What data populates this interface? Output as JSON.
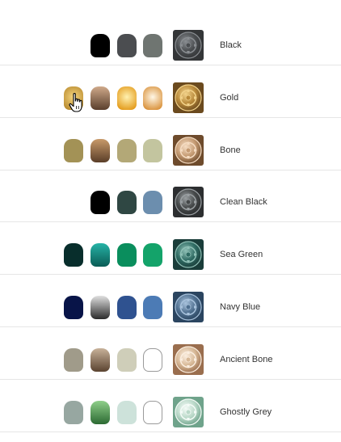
{
  "colours": [
    {
      "name": "Black",
      "thumb": {
        "bg": "#343638",
        "mid": "#4a4d50",
        "hi": "#8a8e92"
      },
      "pots": [
        {
          "type": "solid",
          "c": "#000000"
        },
        {
          "type": "solid",
          "c": "#4b4d50"
        },
        {
          "type": "solid",
          "c": "#6f7571"
        }
      ]
    },
    {
      "name": "Gold",
      "thumb": {
        "bg": "#6b4a1e",
        "mid": "#b8893a",
        "hi": "#f2d28a"
      },
      "pots": [
        {
          "type": "metal",
          "c1": "#f6d680",
          "c2": "#b88a2e"
        },
        {
          "type": "grad",
          "c1": "#cfa98a",
          "c2": "#5a3f2c"
        },
        {
          "type": "metal",
          "c1": "#fff1b0",
          "c2": "#e39a1a"
        },
        {
          "type": "metal",
          "c1": "#fff7e6",
          "c2": "#d9913a"
        }
      ]
    },
    {
      "name": "Bone",
      "thumb": {
        "bg": "#6e4b2c",
        "mid": "#c49a72",
        "hi": "#f5dcc2"
      },
      "pots": [
        {
          "type": "solid",
          "c": "#a39256"
        },
        {
          "type": "grad",
          "c1": "#c89a6a",
          "c2": "#5a3e28"
        },
        {
          "type": "solid",
          "c": "#b3a877"
        },
        {
          "type": "solid",
          "c": "#c3c59f"
        }
      ]
    },
    {
      "name": "Clean Black",
      "thumb": {
        "bg": "#2c2e30",
        "mid": "#454849",
        "hi": "#9a9fa2"
      },
      "pots": [
        {
          "type": "solid",
          "c": "#000000"
        },
        {
          "type": "solid",
          "c": "#2f4743"
        },
        {
          "type": "solid",
          "c": "#6c8eae"
        }
      ]
    },
    {
      "name": "Sea Green",
      "thumb": {
        "bg": "#1a3d3a",
        "mid": "#2f6b63",
        "hi": "#8fc0b6"
      },
      "pots": [
        {
          "type": "solid",
          "c": "#082e2c"
        },
        {
          "type": "grad",
          "c1": "#26b3a6",
          "c2": "#0a5b55"
        },
        {
          "type": "solid",
          "c": "#0a8e5d"
        },
        {
          "type": "solid",
          "c": "#14a36a"
        }
      ]
    },
    {
      "name": "Navy Blue",
      "thumb": {
        "bg": "#2b4560",
        "mid": "#4f6f8f",
        "hi": "#a8c2dc"
      },
      "pots": [
        {
          "type": "solid",
          "c": "#081448"
        },
        {
          "type": "grad",
          "c1": "#e0e0e0",
          "c2": "#2a2a2a"
        },
        {
          "type": "solid",
          "c": "#2f5290"
        },
        {
          "type": "solid",
          "c": "#4c7bb5"
        }
      ]
    },
    {
      "name": "Ancient Bone",
      "thumb": {
        "bg": "#9a6e4e",
        "mid": "#d7b896",
        "hi": "#fbeee0"
      },
      "pots": [
        {
          "type": "solid",
          "c": "#a09b8a"
        },
        {
          "type": "grad",
          "c1": "#c8b29a",
          "c2": "#5a4330"
        },
        {
          "type": "solid",
          "c": "#cfceb9"
        },
        {
          "type": "outline"
        }
      ]
    },
    {
      "name": "Ghostly Grey",
      "thumb": {
        "bg": "#6fa38b",
        "mid": "#b9d8c8",
        "hi": "#f4fbf7"
      },
      "pots": [
        {
          "type": "solid",
          "c": "#97a7a1"
        },
        {
          "type": "grad",
          "c1": "#8fcf8a",
          "c2": "#2c6a32"
        },
        {
          "type": "solid",
          "c": "#cde2da"
        },
        {
          "type": "outline"
        }
      ]
    }
  ]
}
